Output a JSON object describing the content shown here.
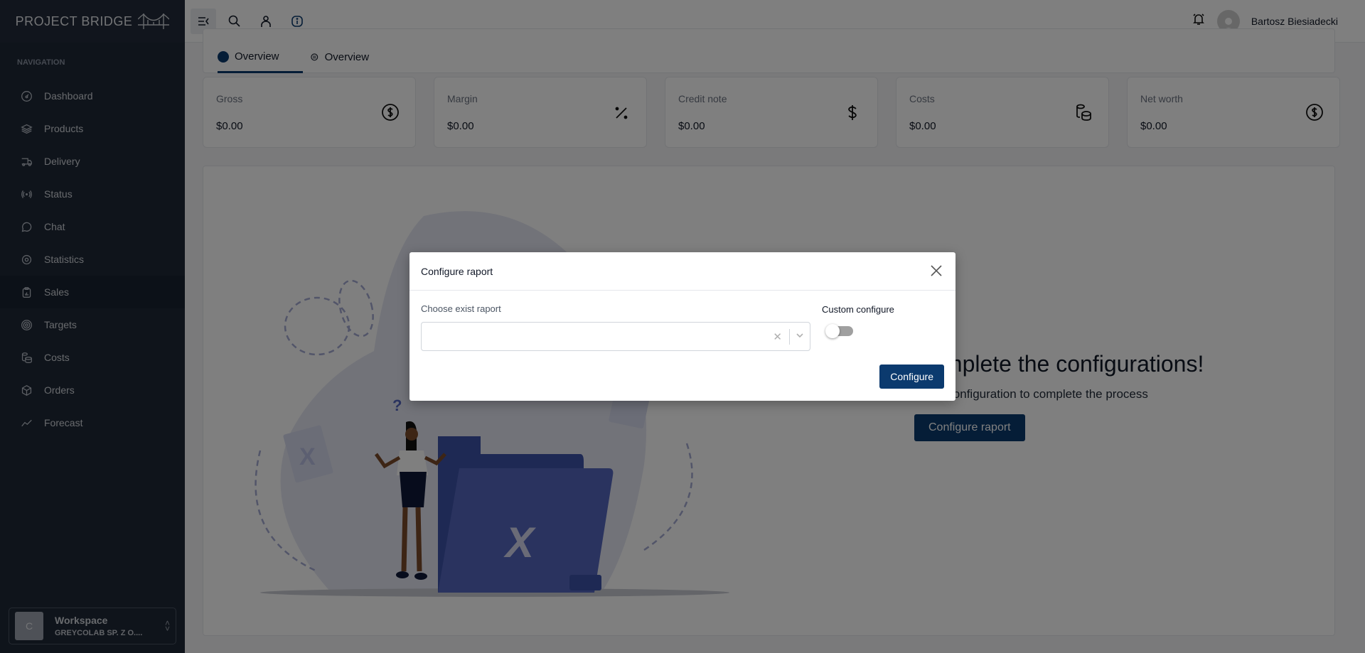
{
  "app": {
    "brand": "PROJECT BRIDGE"
  },
  "sidebar": {
    "heading": "NAVIGATION",
    "items": [
      {
        "label": "Dashboard",
        "icon": "dashboard-icon"
      },
      {
        "label": "Products",
        "icon": "layers-icon"
      },
      {
        "label": "Delivery",
        "icon": "truck-icon"
      },
      {
        "label": "Status",
        "icon": "broadcast-icon"
      },
      {
        "label": "Chat",
        "icon": "chat-icon"
      },
      {
        "label": "Statistics",
        "icon": "statistics-icon"
      },
      {
        "label": "Sales",
        "icon": "clipboard-chart-icon",
        "active": true
      },
      {
        "label": "Targets",
        "icon": "target-icon"
      },
      {
        "label": "Costs",
        "icon": "coins-icon"
      },
      {
        "label": "Orders",
        "icon": "box-icon"
      },
      {
        "label": "Forecast",
        "icon": "trend-line-icon"
      }
    ],
    "workspace": {
      "avatar_letter": "C",
      "title": "Workspace",
      "name": "GREYCOLAB SP. Z O...."
    }
  },
  "topbar": {
    "icons": [
      "collapse-menu-icon",
      "search-icon",
      "user-icon",
      "info-icon"
    ],
    "user_name": "Bartosz Biesiadecki"
  },
  "tabs": [
    {
      "label": "Overview",
      "active": true
    },
    {
      "label": "Overview",
      "active": false
    }
  ],
  "stats": [
    {
      "label": "Gross",
      "value": "$0.00",
      "icon": "dollar-circle-icon"
    },
    {
      "label": "Margin",
      "value": "$0.00",
      "icon": "percent-icon"
    },
    {
      "label": "Credit note",
      "value": "$0.00",
      "icon": "dollar-icon"
    },
    {
      "label": "Costs",
      "value": "$0.00",
      "icon": "coins-icon"
    },
    {
      "label": "Net worth",
      "value": "$0.00",
      "icon": "dollar-circle-icon"
    }
  ],
  "empty_state": {
    "title": "Complete the configurations!",
    "subtitle": "Go to configuration to complete the process",
    "button": "Configure raport"
  },
  "modal": {
    "title": "Configure raport",
    "select_label": "Choose exist raport",
    "select_value": "",
    "custom_label": "Custom configure",
    "custom_enabled": false,
    "configure_button": "Configure",
    "clear_glyph": "✕"
  },
  "colors": {
    "accent": "#0b3a6e",
    "sidebar_bg": "#1f2937"
  }
}
